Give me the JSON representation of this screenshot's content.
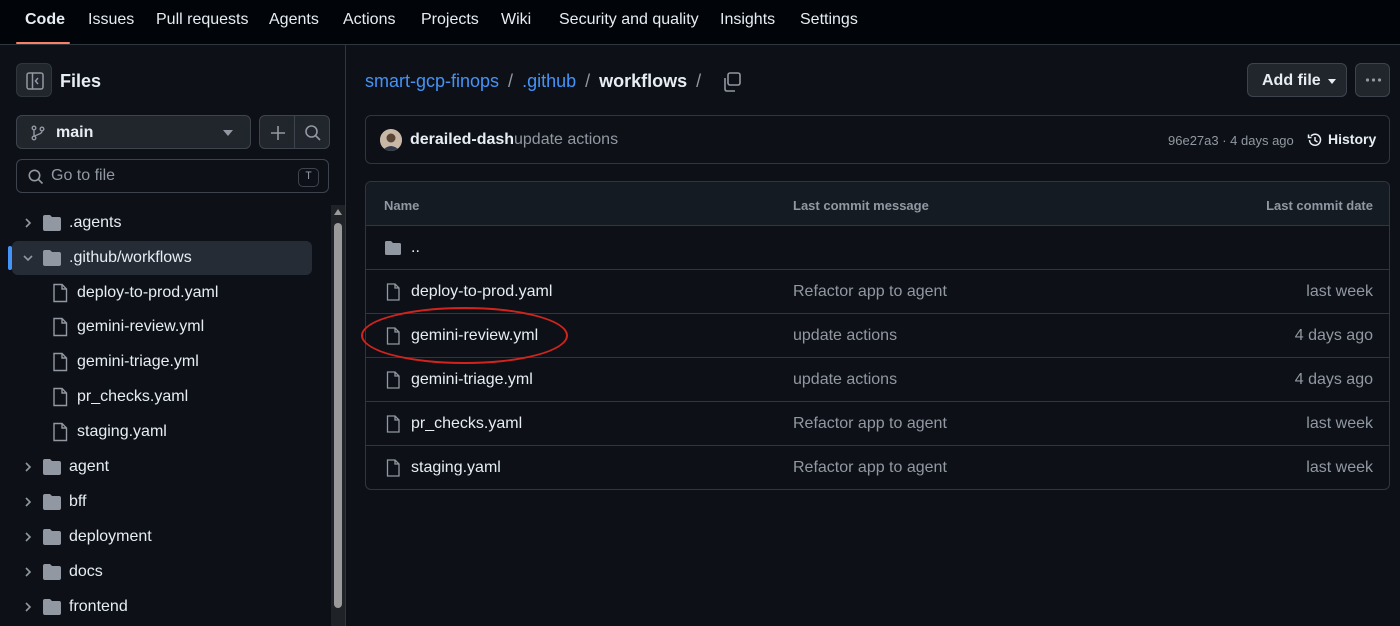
{
  "topnav": {
    "tabs": [
      {
        "label": "Code",
        "active": true
      },
      {
        "label": "Issues"
      },
      {
        "label": "Pull requests"
      },
      {
        "label": "Agents"
      },
      {
        "label": "Actions"
      },
      {
        "label": "Projects"
      },
      {
        "label": "Wiki"
      },
      {
        "label": "Security and quality"
      },
      {
        "label": "Insights"
      },
      {
        "label": "Settings"
      }
    ]
  },
  "sidebar": {
    "title": "Files",
    "branch": "main",
    "search_placeholder": "Go to file",
    "search_shortcut": "T",
    "tree": [
      {
        "label": ".agents",
        "type": "folder",
        "expanded": false
      },
      {
        "label": ".github/workflows",
        "type": "folder",
        "expanded": true,
        "selected": true
      },
      {
        "label": "deploy-to-prod.yaml",
        "type": "file"
      },
      {
        "label": "gemini-review.yml",
        "type": "file"
      },
      {
        "label": "gemini-triage.yml",
        "type": "file"
      },
      {
        "label": "pr_checks.yaml",
        "type": "file"
      },
      {
        "label": "staging.yaml",
        "type": "file"
      },
      {
        "label": "agent",
        "type": "folder",
        "expanded": false
      },
      {
        "label": "bff",
        "type": "folder",
        "expanded": false
      },
      {
        "label": "deployment",
        "type": "folder",
        "expanded": false
      },
      {
        "label": "docs",
        "type": "folder",
        "expanded": false
      },
      {
        "label": "frontend",
        "type": "folder",
        "expanded": false
      }
    ]
  },
  "breadcrumb": {
    "repo": "smart-gcp-finops",
    "folder": ".github",
    "current": "workflows",
    "separator": "/"
  },
  "actions": {
    "add_file": "Add file"
  },
  "latest_commit": {
    "author": "derailed-dash",
    "message": "update actions",
    "meta": "96e27a3 · 4 days ago",
    "history_label": "History"
  },
  "file_table": {
    "columns": [
      "Name",
      "Last commit message",
      "Last commit date"
    ],
    "parent_label": "..",
    "rows": [
      {
        "name": "deploy-to-prod.yaml",
        "message": "Refactor app to agent",
        "date": "last week"
      },
      {
        "name": "gemini-review.yml",
        "message": "update actions",
        "date": "4 days ago",
        "highlighted": true
      },
      {
        "name": "gemini-triage.yml",
        "message": "update actions",
        "date": "4 days ago"
      },
      {
        "name": "pr_checks.yaml",
        "message": "Refactor app to agent",
        "date": "last week"
      },
      {
        "name": "staging.yaml",
        "message": "Refactor app to agent",
        "date": "last week"
      }
    ]
  },
  "colors": {
    "background": "#0d1117",
    "link": "#4493f8",
    "active_tab_underline": "#f78166",
    "annotation": "#d2241d"
  }
}
